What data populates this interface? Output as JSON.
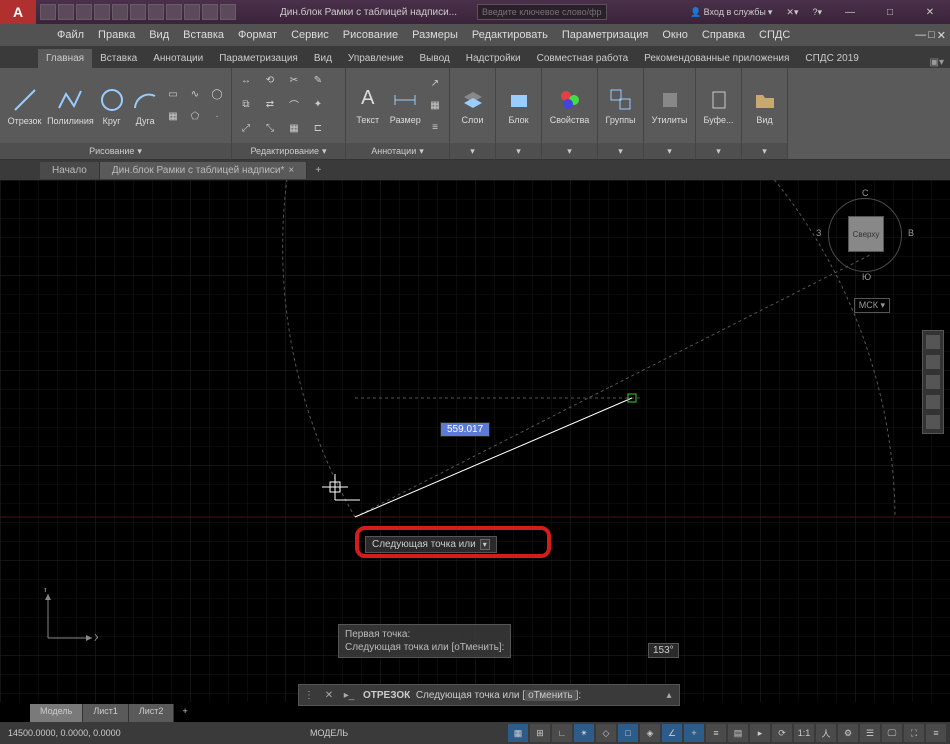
{
  "app_logo": "A",
  "doc_title": "Дин.блок Рамки с таблицей надписи...",
  "search_placeholder": "Введите ключевое слово/фразу",
  "login_label": "Вход в службы",
  "menus": [
    "Файл",
    "Правка",
    "Вид",
    "Вставка",
    "Формат",
    "Сервис",
    "Рисование",
    "Размеры",
    "Редактировать",
    "Параметризация",
    "Окно",
    "Справка",
    "СПДС"
  ],
  "ribbon_tabs": [
    "Главная",
    "Вставка",
    "Аннотации",
    "Параметризация",
    "Вид",
    "Управление",
    "Вывод",
    "Надстройки",
    "Совместная работа",
    "Рекомендованные приложения",
    "СПДС 2019"
  ],
  "ribbon_active": 0,
  "draw_panel": {
    "title": "Рисование",
    "buttons": {
      "line": "Отрезок",
      "polyline": "Полилиния",
      "circle": "Круг",
      "arc": "Дуга"
    }
  },
  "modify_panel": {
    "title": "Редактирование"
  },
  "annot_panel": {
    "title": "Аннотации",
    "text": "Текст",
    "dim": "Размер"
  },
  "layers": "Слои",
  "block": "Блок",
  "props": "Свойства",
  "groups": "Группы",
  "utils": "Утилиты",
  "buffer": "Буфе...",
  "view": "Вид",
  "doc_tabs": {
    "home": "Начало",
    "doc": "Дин.блок Рамки с таблицей надписи*"
  },
  "viewcube": {
    "top": "Сверху",
    "n": "С",
    "s": "Ю",
    "e": "В",
    "w": "З",
    "mck": "МСК"
  },
  "dyn_value": "559.017",
  "tooltip_text": "Следующая точка или",
  "cmd_hist_1": "Первая точка:",
  "cmd_hist_2": "Следующая точка или [оТменить]:",
  "angle_text": "153°",
  "cmd_name": "ОТРЕЗОК",
  "cmd_prompt": "Следующая точка или",
  "cmd_opt": "оТменить",
  "model_tabs": [
    "Модель",
    "Лист1",
    "Лист2"
  ],
  "status_label": "МОДЕЛЬ",
  "coords": "14500.0000, 0.0000, 0.0000",
  "ucs": {
    "x": "X",
    "y": "Y"
  }
}
